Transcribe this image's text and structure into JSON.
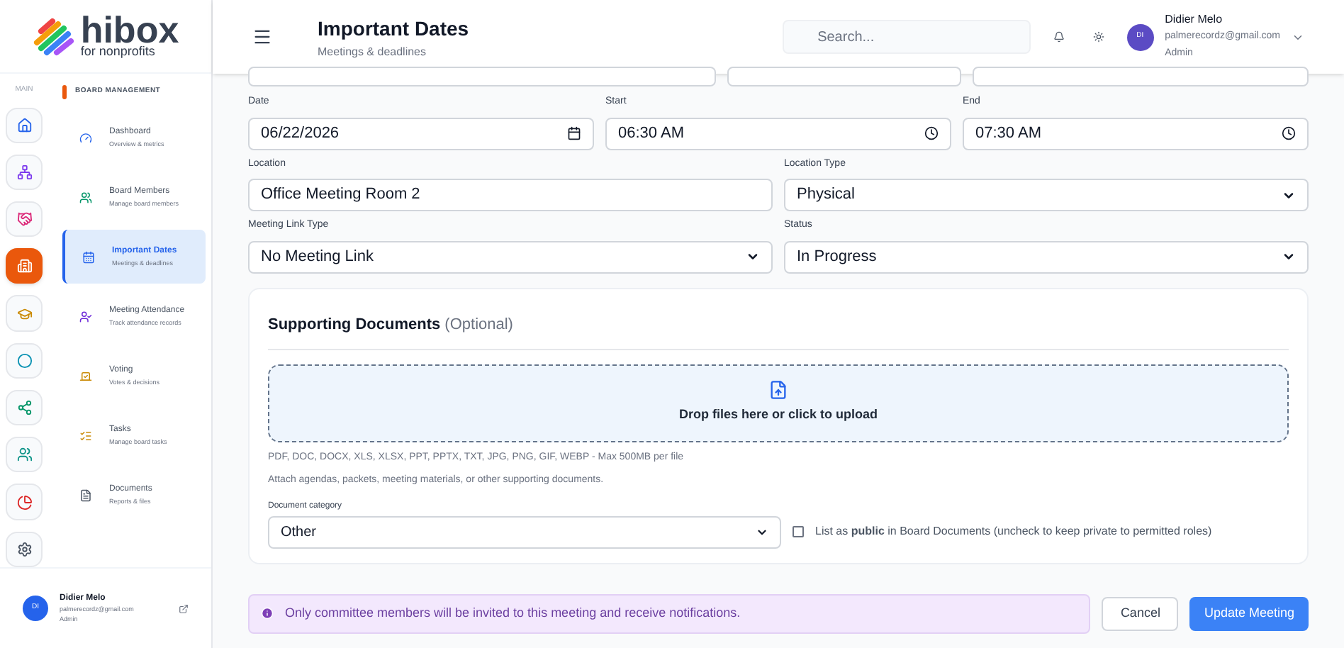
{
  "logo": {
    "name": "hibox",
    "tagline": "for nonprofits"
  },
  "rail": {
    "label": "MAIN",
    "items": [
      {
        "selected": false
      },
      {
        "selected": false
      },
      {
        "selected": false
      },
      {
        "selected": true
      },
      {
        "selected": false
      },
      {
        "selected": false
      },
      {
        "selected": false
      },
      {
        "selected": false
      },
      {
        "selected": false
      },
      {
        "selected": false
      }
    ]
  },
  "menu": {
    "section": "BOARD MANAGEMENT",
    "items": [
      {
        "title": "Dashboard",
        "subtitle": "Overview & metrics",
        "selected": false
      },
      {
        "title": "Board Members",
        "subtitle": "Manage board members",
        "selected": false
      },
      {
        "title": "Important Dates",
        "subtitle": "Meetings & deadlines",
        "selected": true
      },
      {
        "title": "Meeting Attendance",
        "subtitle": "Track attendance records",
        "selected": false
      },
      {
        "title": "Voting",
        "subtitle": "Votes & decisions",
        "selected": false
      },
      {
        "title": "Tasks",
        "subtitle": "Manage board tasks",
        "selected": false
      },
      {
        "title": "Documents",
        "subtitle": "Reports & files",
        "selected": false
      }
    ]
  },
  "sidebar_user": {
    "initials": "DI",
    "name": "Didier Melo",
    "email": "palmerecordz@gmail.com",
    "role": "Admin"
  },
  "header": {
    "title": "Important Dates",
    "subtitle": "Meetings & deadlines",
    "search": {
      "placeholder": "Search..."
    },
    "user": {
      "initials": "DI",
      "name": "Didier Melo",
      "email": "palmerecordz@gmail.com",
      "role": "Admin"
    }
  },
  "form": {
    "rows": [
      [
        {
          "label": "Date",
          "kind": "date",
          "value": "06/22/2026"
        },
        {
          "label": "Start",
          "kind": "time",
          "value": "06:30  AM"
        },
        {
          "label": "End",
          "kind": "time",
          "value": "07:30  AM"
        }
      ],
      [
        {
          "label": "Location",
          "kind": "text",
          "value": "Office Meeting Room 2"
        },
        {
          "label": "Location Type",
          "kind": "select",
          "value": "Physical"
        }
      ],
      [
        {
          "label": "Meeting Link Type",
          "kind": "select",
          "value": "No Meeting Link"
        },
        {
          "label": "Status",
          "kind": "select",
          "value": "In Progress"
        }
      ]
    ]
  },
  "documents": {
    "title": "Supporting Documents",
    "optional": "(Optional)",
    "dropzone": "Drop files here or click to upload",
    "formats": "PDF, DOC, DOCX, XLS, XLSX, PPT, PPTX, TXT, JPG, PNG, GIF, WEBP - Max 500MB per file",
    "hint": "Attach agendas, packets, meeting materials, or other supporting documents.",
    "category": {
      "label": "Document category",
      "value": "Other"
    },
    "public": {
      "label": "List as **public** in Board Documents (uncheck to keep private to permitted roles)",
      "checked": false
    }
  },
  "notice": "Only committee members will be invited to this meeting and receive notifications.",
  "buttons": {
    "cancel": "Cancel",
    "submit": "Update Meeting"
  }
}
